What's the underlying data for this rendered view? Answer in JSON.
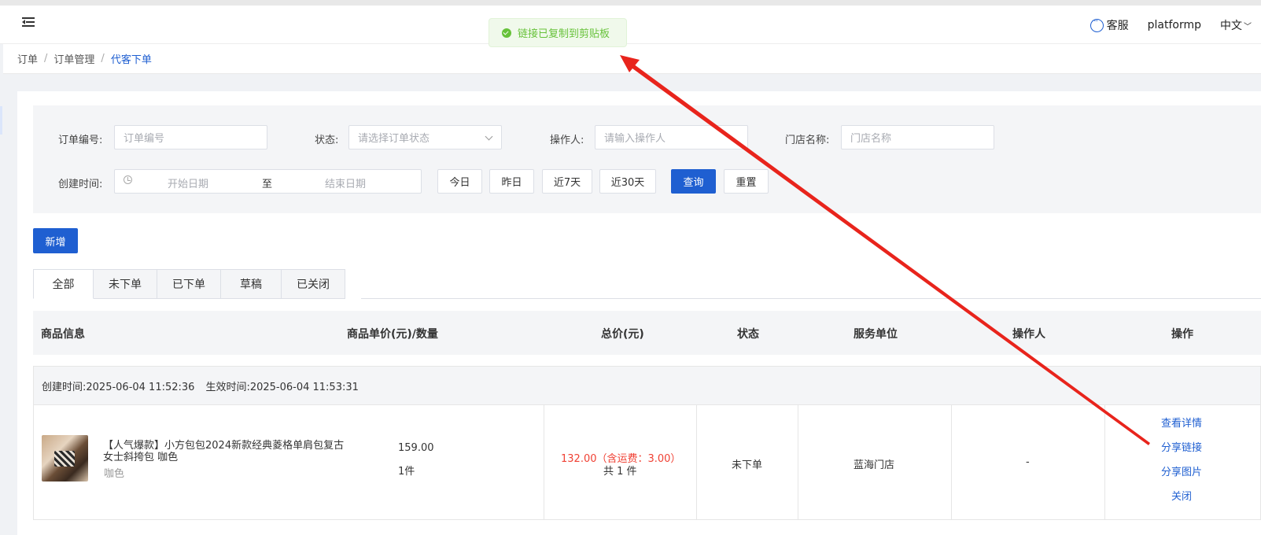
{
  "header": {
    "service_label": "客服",
    "user_label": "platformp",
    "lang_label": "中文"
  },
  "toast": {
    "message": "链接已复制到剪贴板"
  },
  "breadcrumb": {
    "items": [
      "订单",
      "订单管理",
      "代客下单"
    ]
  },
  "filters": {
    "order_no": {
      "label": "订单编号:",
      "placeholder": "订单编号"
    },
    "status": {
      "label": "状态:",
      "placeholder": "请选择订单状态"
    },
    "operator": {
      "label": "操作人:",
      "placeholder": "请输入操作人"
    },
    "store": {
      "label": "门店名称:",
      "placeholder": "门店名称"
    },
    "created_time": {
      "label": "创建时间:",
      "start_placeholder": "开始日期",
      "separator": "至",
      "end_placeholder": "结束日期"
    },
    "quick": [
      "今日",
      "昨日",
      "近7天",
      "近30天"
    ],
    "search_label": "查询",
    "reset_label": "重置"
  },
  "add_label": "新增",
  "tabs": [
    "全部",
    "未下单",
    "已下单",
    "草稿",
    "已关闭"
  ],
  "table": {
    "columns": [
      "商品信息",
      "商品单价(元)/数量",
      "总价(元)",
      "状态",
      "服务单位",
      "操作人",
      "操作"
    ],
    "orders": [
      {
        "created": "创建时间:2025-06-04 11:52:36",
        "effective": "生效时间:2025-06-04 11:53:31",
        "product_name": "【人气爆款】小方包包2024新款经典菱格单肩包复古女士斜挎包 咖色",
        "product_color": "咖色",
        "unit_price": "159.00",
        "quantity": "1件",
        "total": "132.00（含运费：3.00）",
        "total_count": "共 1 件",
        "status": "未下单",
        "service_unit": "蓝海门店",
        "operator": "-",
        "actions": [
          "查看详情",
          "分享链接",
          "分享图片",
          "关闭"
        ]
      }
    ]
  },
  "colors": {
    "primary": "#1f5fd1",
    "success": "#67c23a",
    "price_red": "#f04134",
    "arrow_red": "#e8241c"
  }
}
